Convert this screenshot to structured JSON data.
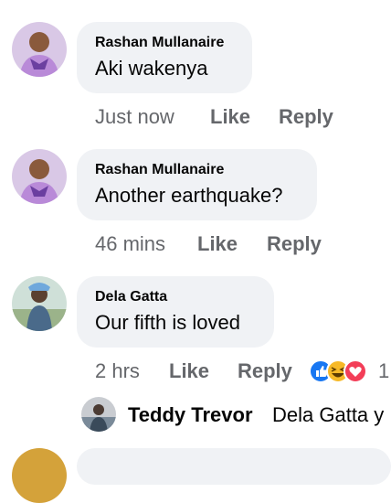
{
  "comments": [
    {
      "author": "Rashan Mullanaire",
      "text": "Aki wakenya",
      "time": "Just now",
      "like_label": "Like",
      "reply_label": "Reply"
    },
    {
      "author": "Rashan Mullanaire",
      "text": "Another earthquake?",
      "time": "46 mins",
      "like_label": "Like",
      "reply_label": "Reply"
    },
    {
      "author": "Dela Gatta",
      "text": "Our fifth is loved",
      "time": "2 hrs",
      "like_label": "Like",
      "reply_label": "Reply",
      "reaction_count": "1"
    }
  ],
  "reply_preview": {
    "author": "Teddy Trevor",
    "text": "Dela Gatta y"
  },
  "colors": {
    "bubble": "#f0f2f5",
    "meta_text": "#65676b",
    "like_reaction": "#1877f2",
    "haha_reaction": "#f7b928",
    "love_reaction": "#f33e58"
  },
  "icons": [
    "like-reaction-icon",
    "haha-reaction-icon",
    "love-reaction-icon"
  ]
}
